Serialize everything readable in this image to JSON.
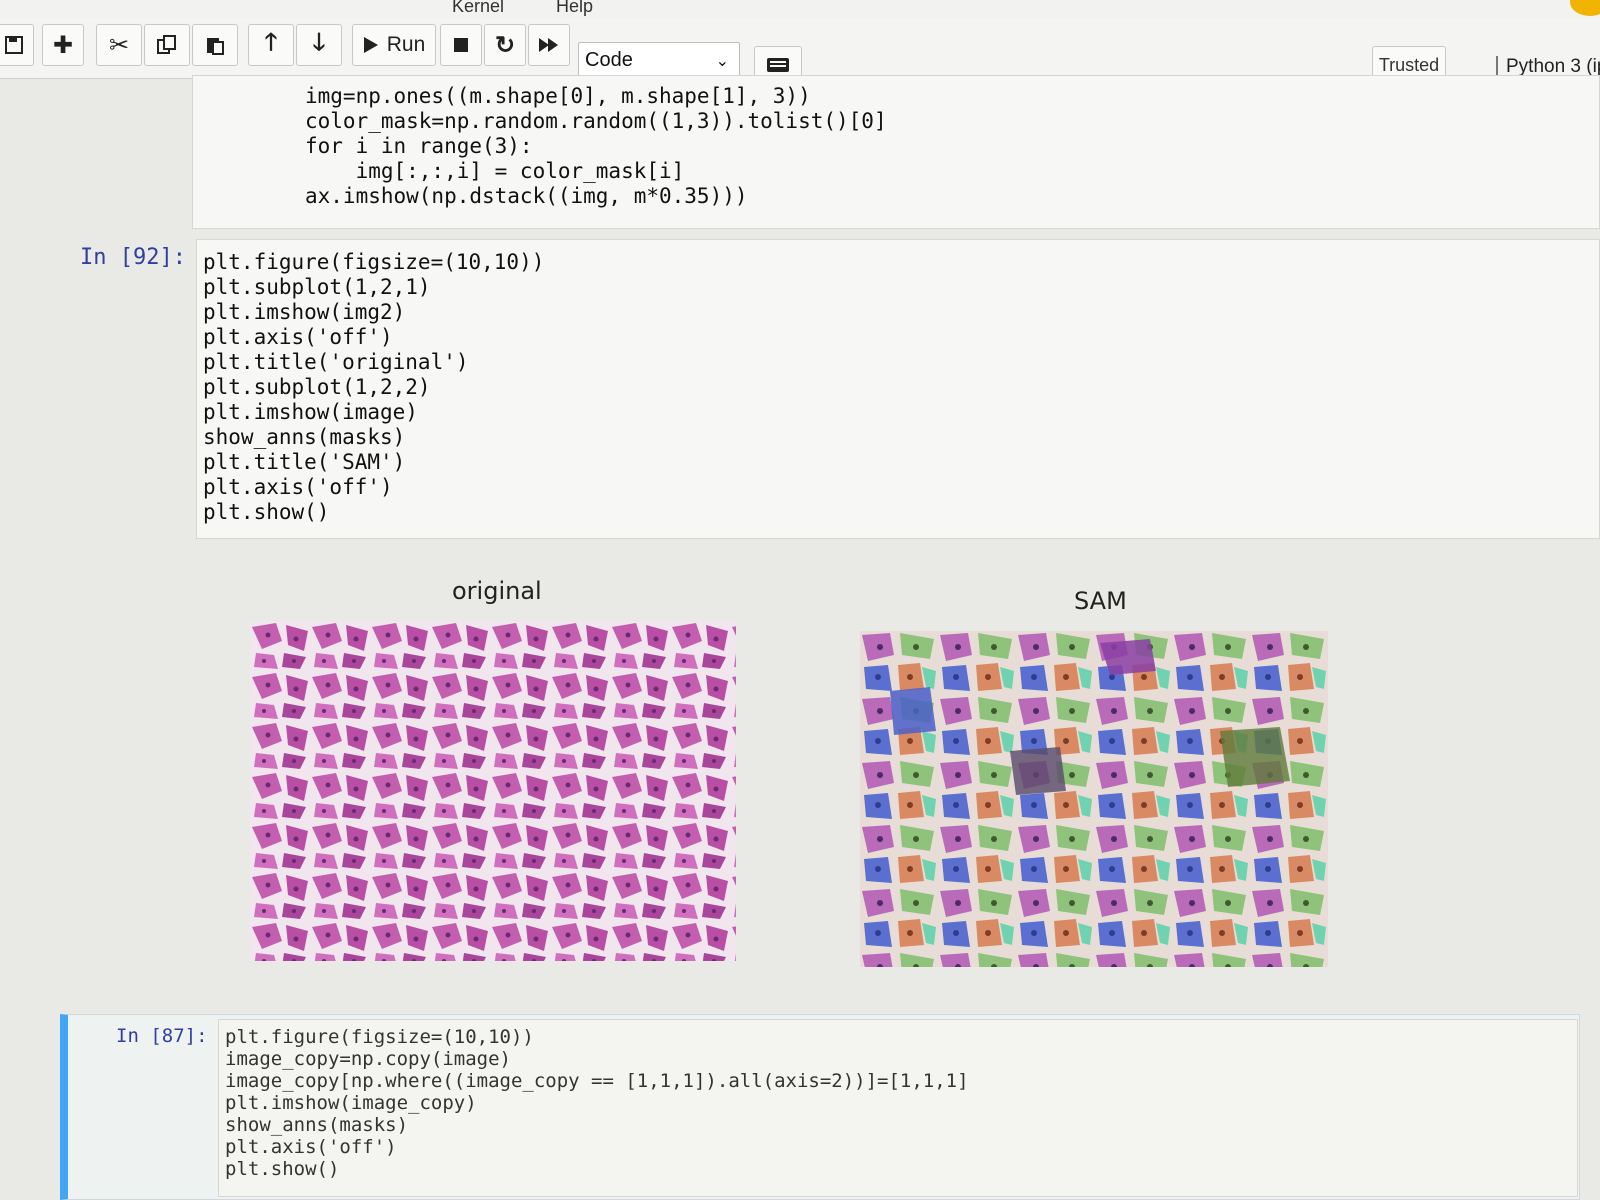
{
  "menubar": {
    "kernel": "Kernel",
    "help": "Help"
  },
  "toolbar": {
    "run_label": "Run",
    "cell_type": "Code",
    "trusted": "Trusted",
    "kernel_name": "Python 3 (ip",
    "icons": [
      "save-icon",
      "plus-icon",
      "scissors-icon",
      "copy-icon",
      "paste-icon",
      "arrow-up-icon",
      "arrow-down-icon",
      "play-icon",
      "stop-icon",
      "restart-icon",
      "fast-forward-icon",
      "keyboard-icon"
    ]
  },
  "cells": [
    {
      "id": "prev",
      "lines": [
        "img=np.ones((m.shape[0], m.shape[1], 3))",
        "color_mask=np.random.random((1,3)).tolist()[0]",
        "for i in range(3):",
        "    img[:,:,i] = color_mask[i]",
        "ax.imshow(np.dstack((img, m*0.35)))"
      ]
    },
    {
      "id": "92",
      "prompt": "In [92]:",
      "lines": [
        "plt.figure(figsize=(10,10))",
        "plt.subplot(1,2,1)",
        "plt.imshow(img2)",
        "plt.axis('off')",
        "plt.title('original')",
        "plt.subplot(1,2,2)",
        "plt.imshow(image)",
        "show_anns(masks)",
        "plt.title('SAM')",
        "plt.axis('off')",
        "plt.show()"
      ]
    },
    {
      "id": "87",
      "prompt": "In [87]:",
      "lines": [
        "plt.figure(figsize=(10,10))",
        "image_copy=np.copy(image)",
        "image_copy[np.where((image_copy == [1,1,1]).all(axis=2))]=[1,1,1]",
        "plt.imshow(image_copy)",
        "show_anns(masks)",
        "plt.axis('off')",
        "plt.show()"
      ]
    }
  ],
  "figure": {
    "left_title": "original",
    "right_title": "SAM"
  },
  "colors": {
    "tissue": "#c45fb0",
    "background": "#f3ecf0",
    "accent": "#42a5f5",
    "prompt": "#303f9f"
  }
}
